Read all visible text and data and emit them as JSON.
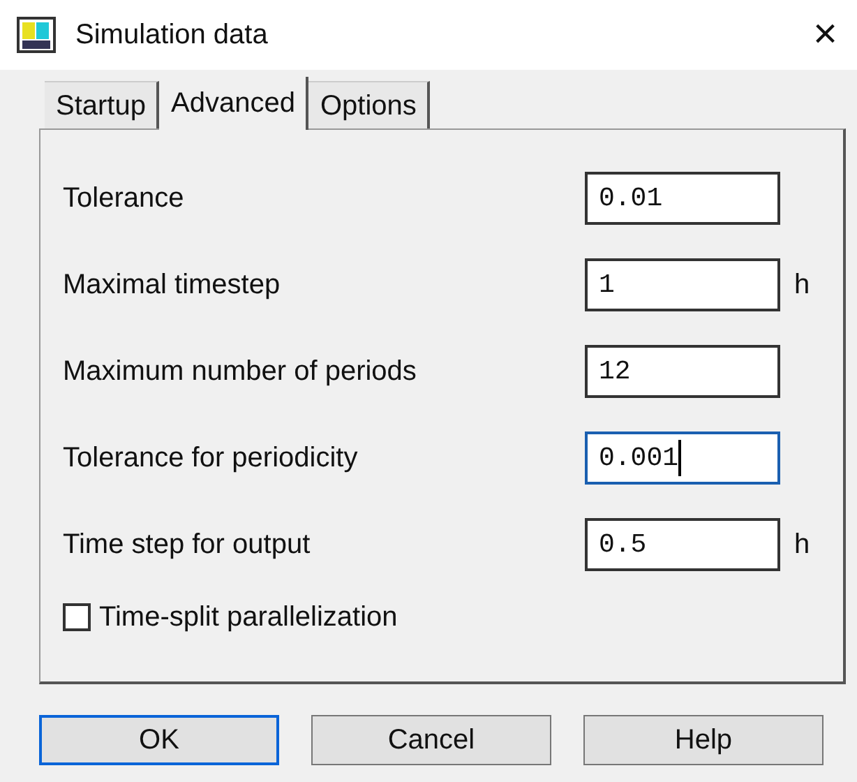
{
  "window": {
    "title": "Simulation data",
    "close": "×"
  },
  "tabs": [
    {
      "label": "Startup",
      "selected": false
    },
    {
      "label": "Advanced",
      "selected": true
    },
    {
      "label": "Options",
      "selected": false
    }
  ],
  "fields": [
    {
      "label": "Tolerance",
      "value": "0.01",
      "focused": false
    },
    {
      "label": "Maximal timestep",
      "value": "1",
      "unit": "h",
      "focused": false
    },
    {
      "label": "Maximum number of periods",
      "value": "12",
      "focused": false
    },
    {
      "label": "Tolerance for periodicity",
      "value": "0.001",
      "focused": true
    },
    {
      "label": "Time step for output",
      "value": "0.5",
      "unit": "h",
      "focused": false
    }
  ],
  "checkbox": {
    "label": "Time-split parallelization",
    "checked": false
  },
  "buttons": [
    {
      "label": "OK",
      "default": true
    },
    {
      "label": "Cancel",
      "default": false
    },
    {
      "label": "Help",
      "default": false
    }
  ]
}
